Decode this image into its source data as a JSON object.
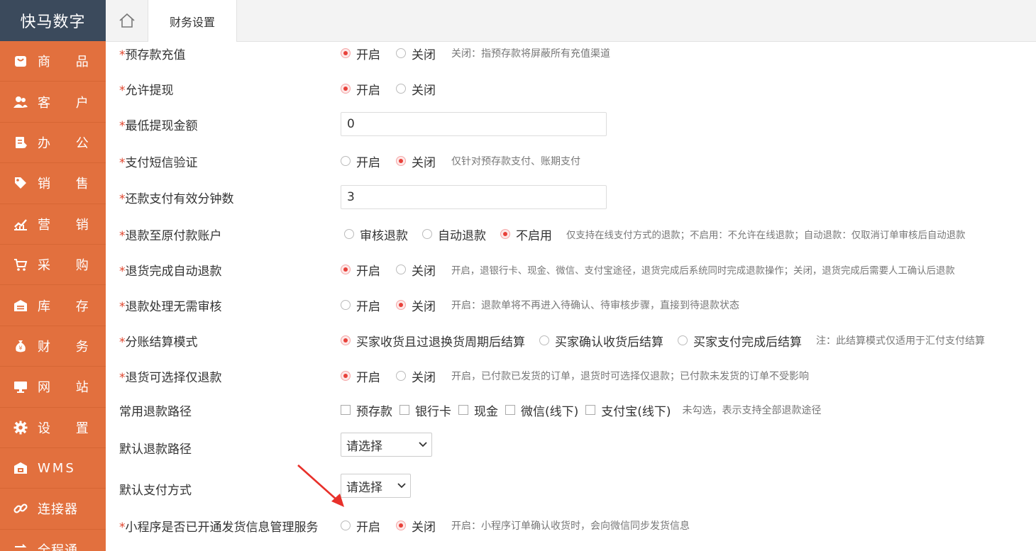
{
  "app": {
    "logo": "快马数字"
  },
  "sidebar": {
    "items": [
      {
        "label": "商 品",
        "icon": "bag-icon"
      },
      {
        "label": "客 户",
        "icon": "users-icon"
      },
      {
        "label": "办 公",
        "icon": "clipboard-icon"
      },
      {
        "label": "销 售",
        "icon": "tag-icon"
      },
      {
        "label": "营 销",
        "icon": "chart-icon"
      },
      {
        "label": "采 购",
        "icon": "cart-icon"
      },
      {
        "label": "库 存",
        "icon": "warehouse-icon"
      },
      {
        "label": "财 务",
        "icon": "money-bag-icon"
      },
      {
        "label": "网 站",
        "icon": "monitor-icon"
      },
      {
        "label": "设 置",
        "icon": "gear-icon"
      },
      {
        "label": "WMS",
        "icon": "wms-box-icon"
      },
      {
        "label": "连接器",
        "icon": "link-icon"
      },
      {
        "label": "全程通",
        "icon": "transfer-icon"
      }
    ]
  },
  "tabs": {
    "active": "财务设置"
  },
  "form": {
    "prepay": {
      "label": "预存款充值",
      "options": [
        "开启",
        "关闭"
      ],
      "selected": 0,
      "hint": "关闭：指预存款将屏蔽所有充值渠道"
    },
    "withdraw": {
      "label": "允许提现",
      "options": [
        "开启",
        "关闭"
      ],
      "selected": 0
    },
    "min_withdraw": {
      "label": "最低提现金额",
      "value": "0"
    },
    "sms_verify": {
      "label": "支付短信验证",
      "options": [
        "开启",
        "关闭"
      ],
      "selected": 1,
      "hint": "仅针对预存款支付、账期支付"
    },
    "repay_minutes": {
      "label": "还款支付有效分钟数",
      "value": "3"
    },
    "refund_original": {
      "label": "退款至原付款账户",
      "options": [
        "审核退款",
        "自动退款",
        "不启用"
      ],
      "selected": 2,
      "hint": "仅支持在线支付方式的退款；不启用：不允许在线退款；自动退款：仅取消订单审核后自动退款"
    },
    "auto_refund": {
      "label": "退货完成自动退款",
      "options": [
        "开启",
        "关闭"
      ],
      "selected": 0,
      "hint": "开启，退银行卡、现金、微信、支付宝途径，退货完成后系统同时完成退款操作；关闭，退货完成后需要人工确认后退款"
    },
    "no_audit": {
      "label": "退款处理无需审核",
      "options": [
        "开启",
        "关闭"
      ],
      "selected": 1,
      "hint": "开启：退款单将不再进入待确认、待审核步骤，直接到待退款状态"
    },
    "split_mode": {
      "label": "分账结算模式",
      "options": [
        "买家收货且过退换货周期后结算",
        "买家确认收货后结算",
        "买家支付完成后结算"
      ],
      "selected": 0,
      "hint": "注：此结算模式仅适用于汇付支付结算"
    },
    "refund_only": {
      "label": "退货可选择仅退款",
      "options": [
        "开启",
        "关闭"
      ],
      "selected": 0,
      "hint": "开启，已付款已发货的订单，退货时可选择仅退款；已付款未发货的订单不受影响"
    },
    "common_paths": {
      "label": "常用退款路径",
      "options": [
        "预存款",
        "银行卡",
        "现金",
        "微信(线下)",
        "支付宝(线下)"
      ],
      "hint": "未勾选，表示支持全部退款途径"
    },
    "default_path": {
      "label": "默认退款路径",
      "value": "请选择"
    },
    "default_pay": {
      "label": "默认支付方式",
      "value": "请选择"
    },
    "mini_program": {
      "label": "小程序是否已开通发货信息管理服务",
      "options": [
        "开启",
        "关闭"
      ],
      "selected": 1,
      "hint": "开启：小程序订单确认收货时，会向微信同步发货信息"
    }
  },
  "colors": {
    "sidebar": "#e2703e",
    "logo_bg": "#3b4a5c",
    "accent": "#e8413a",
    "annotation_arrow": "#e8302a"
  }
}
